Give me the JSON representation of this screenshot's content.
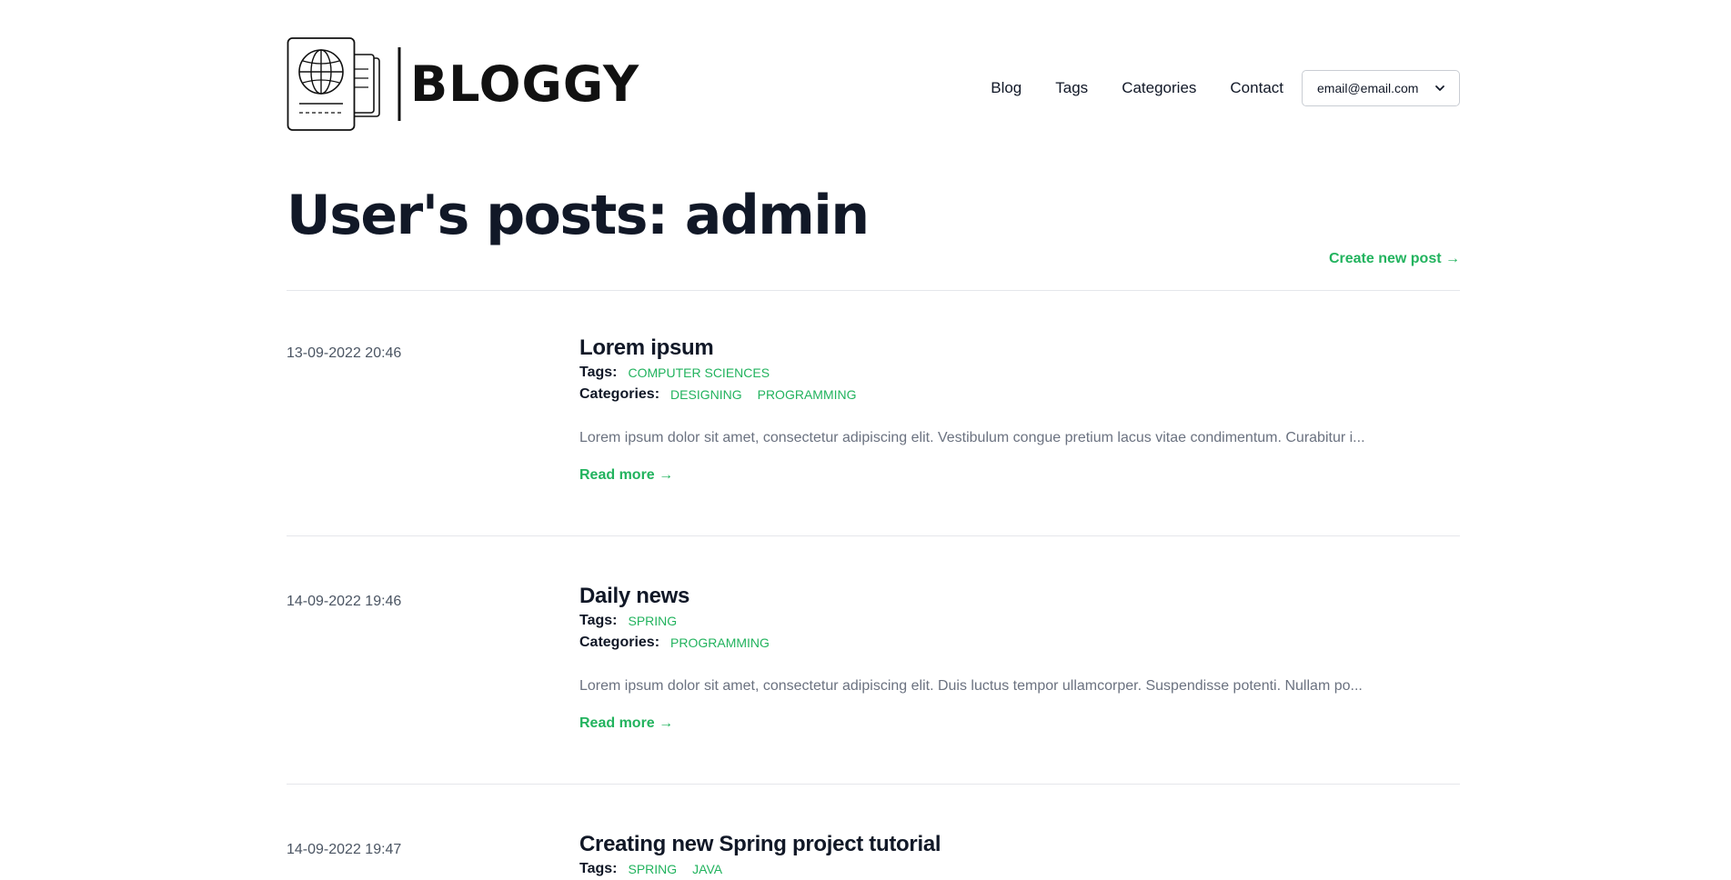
{
  "brand": {
    "name": "BLOGGY",
    "logo_icon": "passport-globe-icon"
  },
  "nav": {
    "items": [
      "Blog",
      "Tags",
      "Categories",
      "Contact"
    ],
    "user_email": "email@email.com",
    "user_dropdown_icon": "chevron-down-icon"
  },
  "page": {
    "title": "User's posts: admin",
    "create_link": "Create new post →"
  },
  "labels": {
    "tags": "Tags:",
    "categories": "Categories:",
    "read_more": "Read more →"
  },
  "colors": {
    "accent": "#22b35e",
    "text": "#111827",
    "muted": "#6b7280",
    "divider": "#e5e7eb"
  },
  "posts": [
    {
      "date": "13-09-2022 20:46",
      "title": "Lorem ipsum",
      "tags": [
        "COMPUTER SCIENCES"
      ],
      "categories": [
        "DESIGNING",
        "PROGRAMMING"
      ],
      "excerpt": "Lorem ipsum dolor sit amet, consectetur adipiscing elit. Vestibulum congue pretium lacus vitae condimentum. Curabitur i..."
    },
    {
      "date": "14-09-2022 19:46",
      "title": "Daily news",
      "tags": [
        "SPRING"
      ],
      "categories": [
        "PROGRAMMING"
      ],
      "excerpt": "Lorem ipsum dolor sit amet, consectetur adipiscing elit. Duis luctus tempor ullamcorper. Suspendisse potenti. Nullam po..."
    },
    {
      "date": "14-09-2022 19:47",
      "title": "Creating new Spring project tutorial",
      "tags": [
        "SPRING",
        "JAVA"
      ],
      "categories": [],
      "excerpt": ""
    }
  ]
}
